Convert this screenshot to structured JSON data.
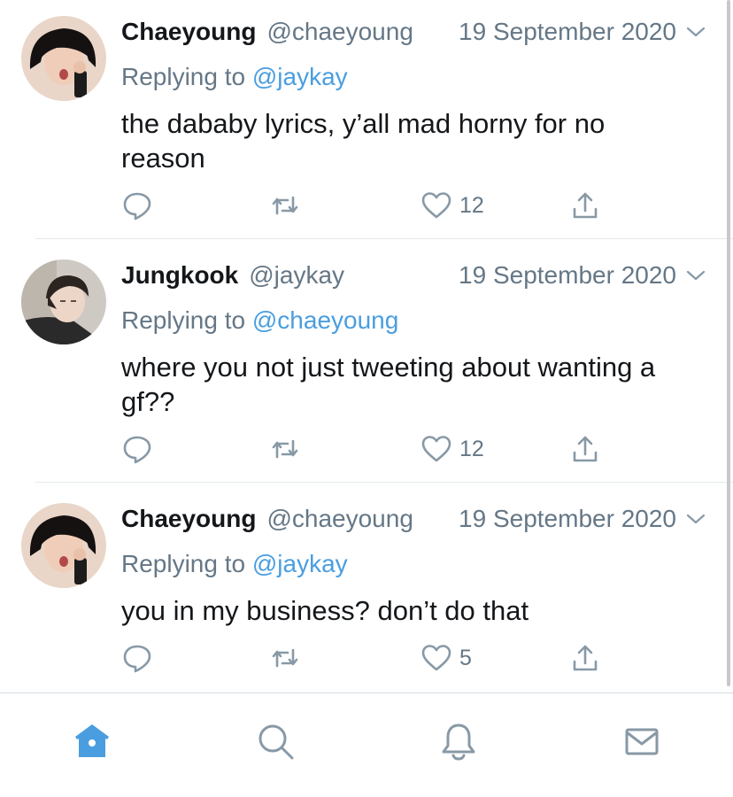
{
  "tweets": [
    {
      "name": "Chaeyoung",
      "handle": "@chaeyoung",
      "date": "19 September 2020",
      "replying_prefix": "Replying to",
      "replying_to": "@jaykay",
      "text": "the dababy lyrics, y’all mad horny for no reason",
      "likes": "12",
      "avatar": "chaeyoung-avatar"
    },
    {
      "name": "Jungkook",
      "handle": "@jaykay",
      "date": "19 September 2020",
      "replying_prefix": "Replying to",
      "replying_to": "@chaeyoung",
      "text": "where you not just tweeting about wanting a gf??",
      "likes": "12",
      "avatar": "jungkook-avatar"
    },
    {
      "name": "Chaeyoung",
      "handle": "@chaeyoung",
      "date": "19 September 2020",
      "replying_prefix": "Replying to",
      "replying_to": "@jaykay",
      "text": "you in my business? don’t do that",
      "likes": "5",
      "avatar": "chaeyoung-avatar"
    }
  ],
  "tabbar": {
    "active_tab": "home",
    "tabs": [
      "home-icon",
      "search-icon",
      "notifications-icon",
      "messages-icon"
    ]
  },
  "colors": {
    "accent": "#4a9ee0",
    "secondary_text": "#657786",
    "primary_text": "#14171a",
    "divider": "#e1e8ed"
  }
}
